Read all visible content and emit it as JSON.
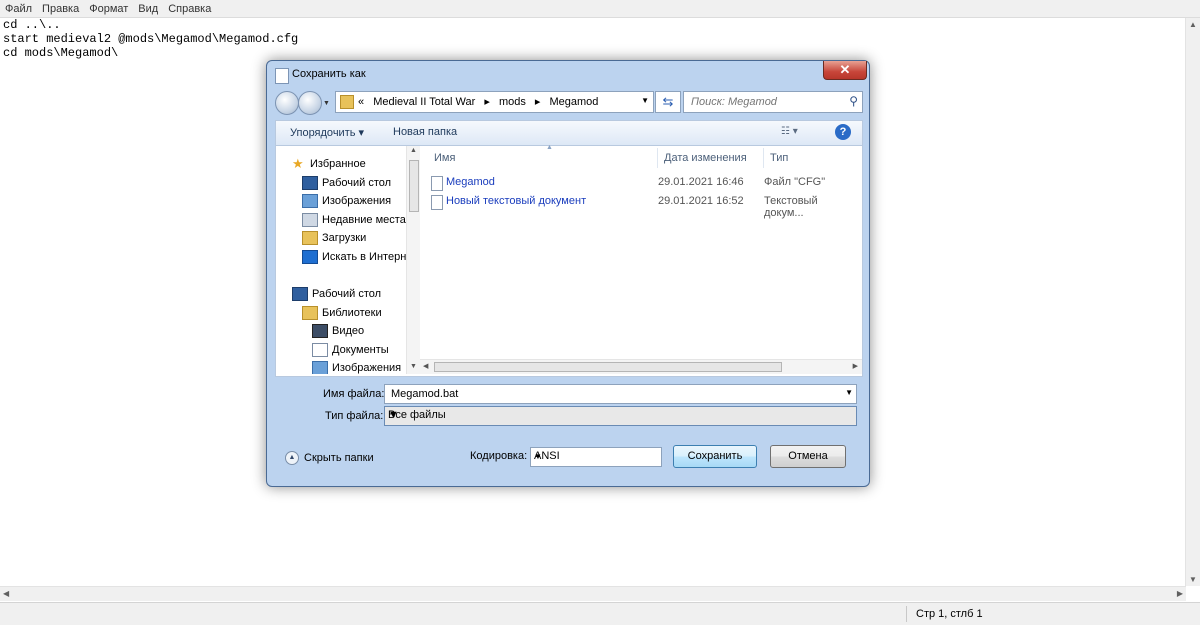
{
  "notepad": {
    "menu": [
      "Файл",
      "Правка",
      "Формат",
      "Вид",
      "Справка"
    ],
    "lines": [
      "cd ..\\..",
      "start medieval2 @mods\\Megamod\\Megamod.cfg",
      "cd mods\\Megamod\\"
    ],
    "status_position": "Стр 1, стлб 1"
  },
  "dialog": {
    "title": "Сохранить как",
    "close_glyph": "✕",
    "breadcrumb": {
      "prefix": "«",
      "parts": [
        "Medieval II Total War",
        "mods",
        "Megamod"
      ],
      "sep": "▸"
    },
    "search_placeholder": "Поиск: Megamod",
    "toolbar": {
      "organize": "Упорядочить",
      "new_folder": "Новая папка",
      "help": "?"
    },
    "nav": {
      "favorites": "Избранное",
      "favorites_items": [
        "Рабочий стол",
        "Изображения",
        "Недавние места",
        "Загрузки",
        "Искать в Интернете"
      ],
      "desktop": "Рабочий стол",
      "libraries": "Библиотеки",
      "library_items": [
        "Видео",
        "Документы",
        "Изображения"
      ]
    },
    "columns": {
      "name": "Имя",
      "date": "Дата изменения",
      "type": "Тип"
    },
    "files": [
      {
        "name": "Megamod",
        "date": "29.01.2021 16:46",
        "type": "Файл \"CFG\""
      },
      {
        "name": "Новый текстовый документ",
        "date": "29.01.2021 16:52",
        "type": "Текстовый докум..."
      }
    ],
    "filename_label": "Имя файла:",
    "filename_value": "Megamod.bat",
    "filetype_label": "Тип файла:",
    "filetype_value": "Все файлы",
    "hide_folders": "Скрыть папки",
    "encoding_label": "Кодировка:",
    "encoding_value": "ANSI",
    "save": "Сохранить",
    "cancel": "Отмена"
  }
}
